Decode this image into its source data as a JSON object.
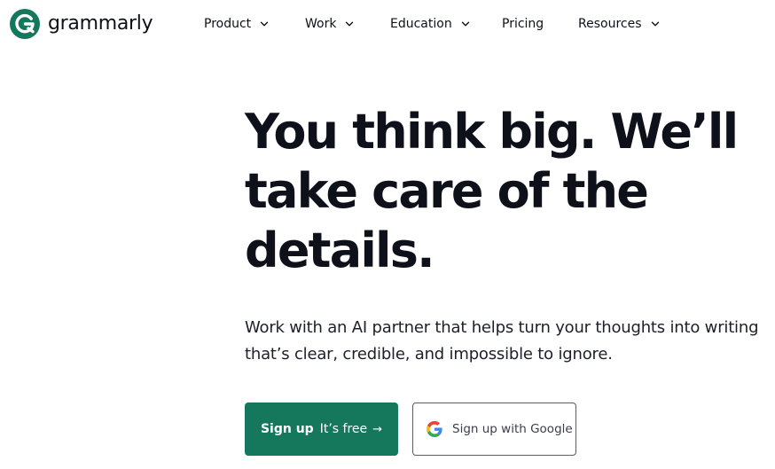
{
  "brand": {
    "name": "grammarly",
    "logo_letter": "G",
    "color": "#15775c"
  },
  "nav": {
    "items": [
      {
        "label": "Product",
        "has_dropdown": true,
        "icon": "chevron-down-icon"
      },
      {
        "label": "Work",
        "has_dropdown": true,
        "icon": "chevron-down-icon"
      },
      {
        "label": "Education",
        "has_dropdown": true,
        "icon": "chevron-down-icon"
      },
      {
        "label": "Pricing",
        "has_dropdown": false
      },
      {
        "label": "Resources",
        "has_dropdown": true,
        "icon": "chevron-down-icon"
      }
    ]
  },
  "hero": {
    "title_lines": [
      "You think big. We’ll",
      "take care of the",
      "details."
    ],
    "subtitle_lines": [
      "Work with an AI partner that helps turn your thoughts into writing",
      "that’s clear, credible, and impossible to ignore."
    ]
  },
  "cta": {
    "primary_strong": "Sign up",
    "primary_light": "It’s free",
    "primary_arrow": "→",
    "primary_color": "#15775c",
    "google_label": "Sign up with Google",
    "google_icon": "google-icon"
  },
  "colors": {
    "text": "#0e101a",
    "accent": "#15775c",
    "border": "#5a5d68"
  }
}
